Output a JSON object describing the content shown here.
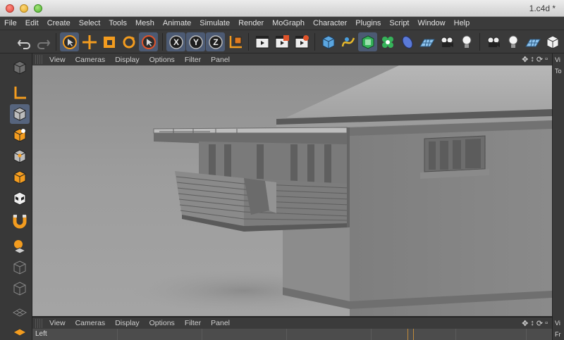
{
  "window": {
    "title": "1.c4d *"
  },
  "menu": [
    "File",
    "Edit",
    "Create",
    "Select",
    "Tools",
    "Mesh",
    "Animate",
    "Simulate",
    "Render",
    "MoGraph",
    "Character",
    "Plugins",
    "Script",
    "Window",
    "Help"
  ],
  "toolbar": {
    "axis_x": "X",
    "axis_y": "Y",
    "axis_z": "Z"
  },
  "viewport_top": {
    "menus": [
      "View",
      "Cameras",
      "Display",
      "Options",
      "Filter",
      "Panel"
    ]
  },
  "viewport_bottom": {
    "menus": [
      "View",
      "Cameras",
      "Display",
      "Options",
      "Filter",
      "Panel"
    ],
    "view_label": "Left"
  },
  "right_panel": {
    "label_top": "Vi",
    "label_top2": "To",
    "label_bottom": "Vi",
    "label_bottom2": "Fr"
  },
  "colors": {
    "accent": "#f39c1f",
    "selected_tool": "#56647d",
    "ui_dark": "#3a3a3a",
    "viewport_bg": "#9a9a9a"
  }
}
